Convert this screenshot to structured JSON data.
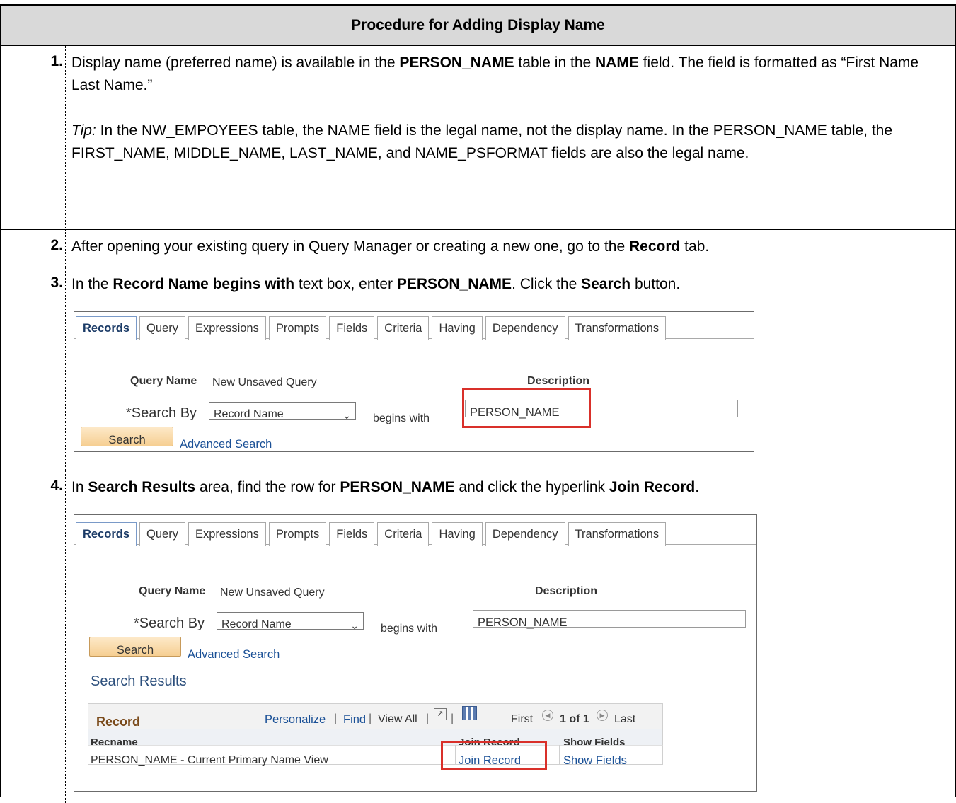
{
  "header": {
    "title": "Procedure for Adding Display Name"
  },
  "steps": {
    "s1": {
      "num": "1.",
      "pre": "Display name (preferred name) is available in the ",
      "b1": "PERSON_NAME",
      "mid": " table in the ",
      "b2": "NAME",
      "post": " field. The field is formatted as “First Name Last Name.”",
      "tip_label": "Tip:",
      "tip_text": " In the NW_EMPOYEES table, the NAME field is the legal name, not the display name. In the PERSON_NAME table, the FIRST_NAME, MIDDLE_NAME, LAST_NAME, and NAME_PSFORMAT fields are also the legal name."
    },
    "s2": {
      "num": "2.",
      "pre": "After opening your existing query in Query Manager or creating a new one, go to the ",
      "b1": "Record",
      "post": " tab."
    },
    "s3": {
      "num": "3.",
      "pre": "In the ",
      "b1": "Record Name begins with",
      "mid": " text box, enter ",
      "b2": "PERSON_NAME",
      "mid2": ". Click the ",
      "b3": "Search",
      "post": " button."
    },
    "s4": {
      "num": "4.",
      "pre": "In ",
      "b1": "Search Results",
      "mid": " area, find the row for ",
      "b2": "PERSON_NAME",
      "mid2": " and click the hyperlink ",
      "b3": "Join Record",
      "post": "."
    }
  },
  "ps": {
    "tabs": [
      "Records",
      "Query",
      "Expressions",
      "Prompts",
      "Fields",
      "Criteria",
      "Having",
      "Dependency",
      "Transformations"
    ],
    "query_name_label": "Query Name",
    "query_name_value": "New Unsaved Query",
    "description_label": "Description",
    "search_by_label": "*Search By",
    "search_by_value": "Record Name",
    "begins_with": "begins with",
    "search_value": "PERSON_NAME",
    "search_button": "Search",
    "advanced_search": "Advanced Search",
    "search_results": "Search Results",
    "grid": {
      "title": "Record",
      "personalize": "Personalize",
      "find": "Find",
      "view_all": "View All",
      "first": "First",
      "count": "1 of 1",
      "last": "Last",
      "col_recname": "Recname",
      "col_join": "Join Record",
      "col_show": "Show Fields",
      "row_recname": "PERSON_NAME - Current Primary Name View",
      "row_join": "Join Record",
      "row_show": "Show Fields"
    }
  }
}
